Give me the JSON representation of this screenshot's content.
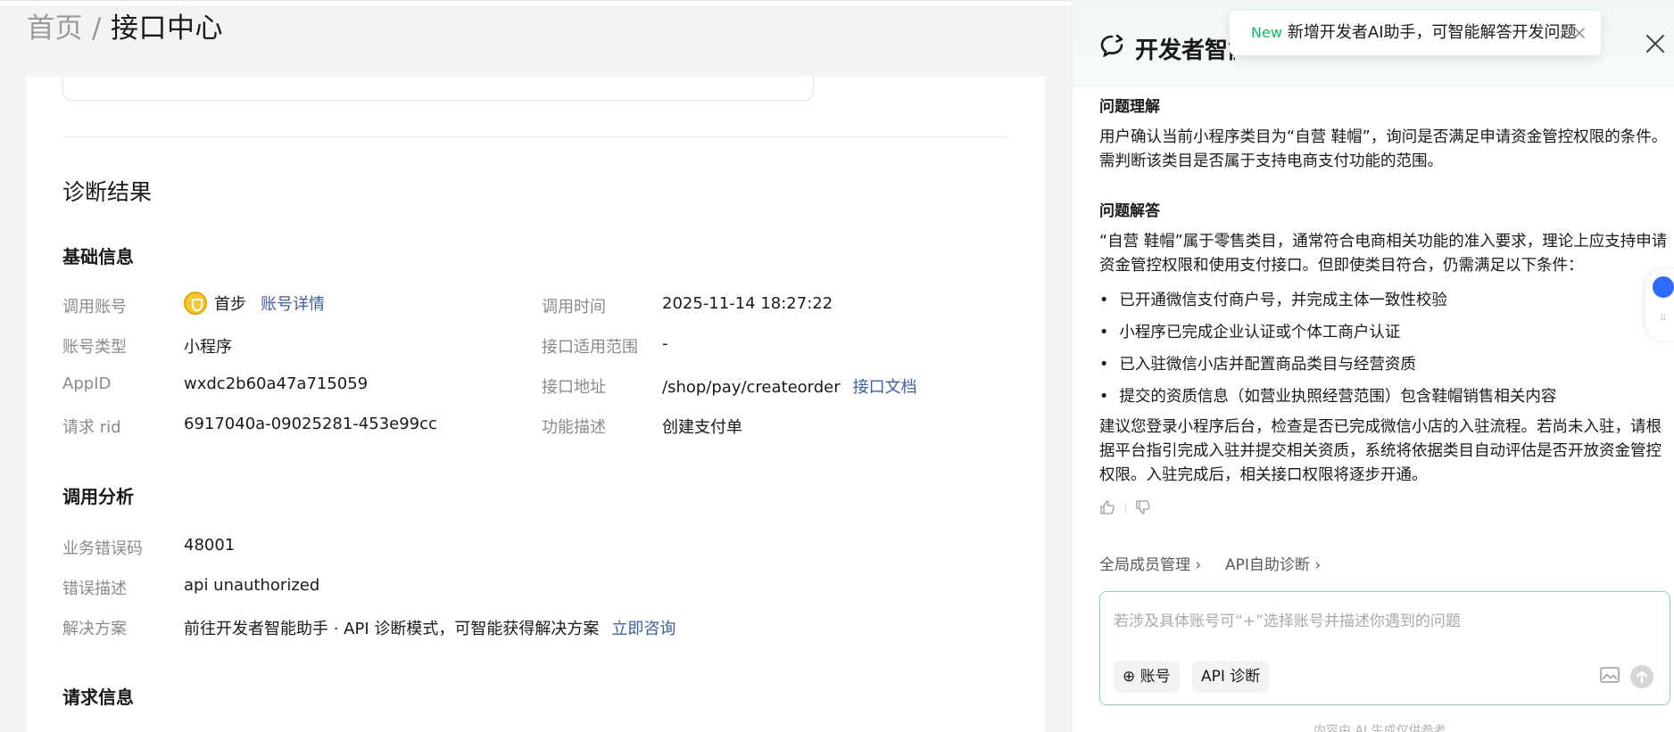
{
  "breadcrumb": {
    "home": "首页",
    "separator": "/",
    "current": "接口中心"
  },
  "diagnosis": {
    "title": "诊断结果",
    "basic": {
      "title": "基础信息",
      "call_account_label": "调用账号",
      "call_account_name": "首步",
      "account_detail_link": "账号详情",
      "account_type_label": "账号类型",
      "account_type_value": "小程序",
      "appid_label": "AppID",
      "appid_value": "wxdc2b60a47a715059",
      "rid_label": "请求 rid",
      "rid_value": "6917040a-09025281-453e99cc",
      "call_time_label": "调用时间",
      "call_time_value": "2025-11-14 18:27:22",
      "scope_label": "接口适用范围",
      "scope_value": "-",
      "api_url_label": "接口地址",
      "api_url_value": "/shop/pay/createorder",
      "api_doc_link": "接口文档",
      "func_label": "功能描述",
      "func_value": "创建支付单"
    },
    "analysis": {
      "title": "调用分析",
      "err_code_label": "业务错误码",
      "err_code_value": "48001",
      "err_desc_label": "错误描述",
      "err_desc_value": "api unauthorized",
      "solution_label": "解决方案",
      "solution_value": "前往开发者智能助手 · API 诊断模式，可智能获得解决方案",
      "consult_link": "立即咨询"
    },
    "request": {
      "title": "请求信息"
    }
  },
  "panel": {
    "title": "开发者智能助手",
    "toast": {
      "tag": "New",
      "text": "新增开发者AI助手，可智能解答开发问题"
    },
    "understanding_heading": "问题理解",
    "understanding_text": "用户确认当前小程序类目为“自营 鞋帽”，询问是否满足申请资金管控权限的条件。需判断该类目是否属于支持电商支付功能的范围。",
    "answer_heading": "问题解答",
    "answer_intro": "“自营 鞋帽”属于零售类目，通常符合电商相关功能的准入要求，理论上应支持申请资金管控权限和使用支付接口。但即使类目符合，仍需满足以下条件：",
    "bullets": [
      "已开通微信支付商户号，并完成主体一致性校验",
      "小程序已完成企业认证或个体工商户认证",
      "已入驻微信小店并配置商品类目与经营资质",
      "提交的资质信息（如营业执照经营范围）包含鞋帽销售相关内容"
    ],
    "answer_outro": "建议您登录小程序后台，检查是否已完成微信小店的入驻流程。若尚未入驻，请根据平台指引完成入驻并提交相关资质，系统将依据类目自动评估是否开放资金管控权限。入驻完成后，相关接口权限将逐步开通。",
    "quick_links": [
      "全局成员管理",
      "API自助诊断"
    ],
    "input_placeholder": "若涉及具体账号可“+”选择账号并描述你遇到的问题",
    "chip_account": "账号",
    "chip_api": "API 诊断",
    "footnote": "内容由 AI 生成仅供参考"
  },
  "colors": {
    "accent": "#07c160",
    "link": "#3e5f9f",
    "input_border": "#86d7ab"
  }
}
